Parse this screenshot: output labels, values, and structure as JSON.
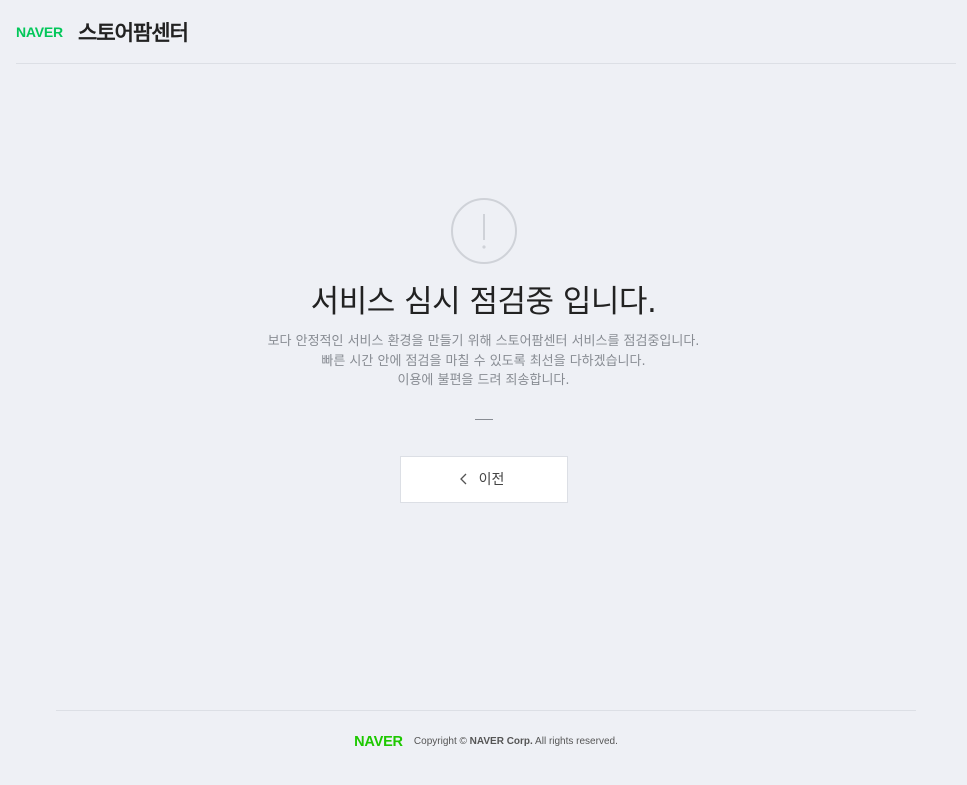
{
  "header": {
    "logo": "NAVER",
    "service_name": "스토어팜센터"
  },
  "notice": {
    "icon": "warning-exclamation-icon",
    "title": "서비스 심시 점검중 입니다.",
    "lines": [
      "보다 안정적인 서비스 환경을 만들기 위해 스토어팜센터 서비스를 점검중입니다.",
      "빠른 시간 안에 점검을 마칠 수 있도록 최선을 다하겠습니다.",
      "이용에 불편을 드려 죄송합니다."
    ],
    "back_button": {
      "label": "이전",
      "icon": "chevron-left-icon"
    }
  },
  "footer": {
    "logo": "NAVER",
    "copyright_prefix": "Copyright ©",
    "company": "NAVER Corp.",
    "rights": "All rights reserved."
  },
  "colors": {
    "background": "#eef0f5",
    "brand_green": "#03c75a",
    "footer_logo_green": "#1ec800",
    "border": "#dcdfe5"
  }
}
